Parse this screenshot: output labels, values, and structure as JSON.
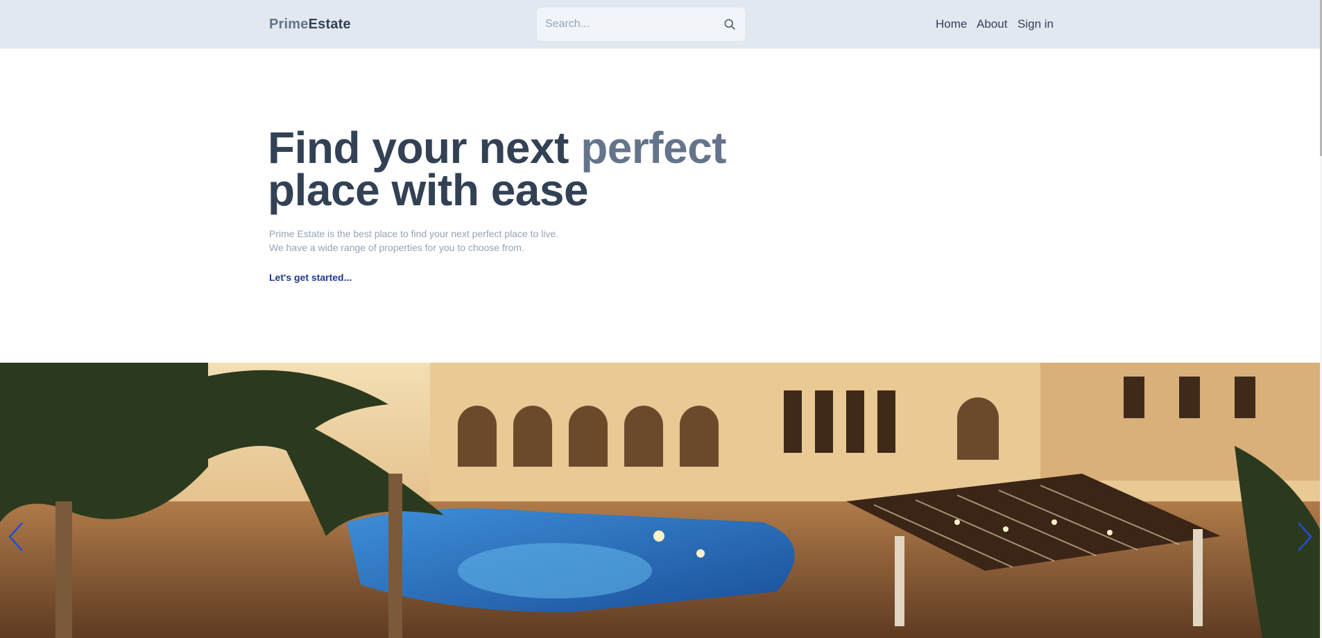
{
  "header": {
    "logo_primary": "Prime",
    "logo_secondary": "Estate",
    "search_placeholder": "Search...",
    "search_icon": "search-icon",
    "nav": [
      "Home",
      "About",
      "Sign in"
    ]
  },
  "hero": {
    "title_line1_start": "Find your next ",
    "title_line1_accent": "perfect",
    "title_line2": "place with ease",
    "subtitle_line1": "Prime Estate is the best place to find your next perfect place to live.",
    "subtitle_line2": "We have a wide range of properties for you to choose from.",
    "cta": "Let's get started..."
  },
  "carousel": {
    "image": "luxury villa courtyard with pool and palm trees at dusk",
    "prev_icon": "chevron-left-icon",
    "next_icon": "chevron-right-icon"
  },
  "colors": {
    "header_bg": "#e2e8f0",
    "heading": "#334155",
    "accent": "#64748b",
    "muted": "#94a3b8",
    "link": "#1e3a8a",
    "arrow": "#1d4ed8"
  }
}
